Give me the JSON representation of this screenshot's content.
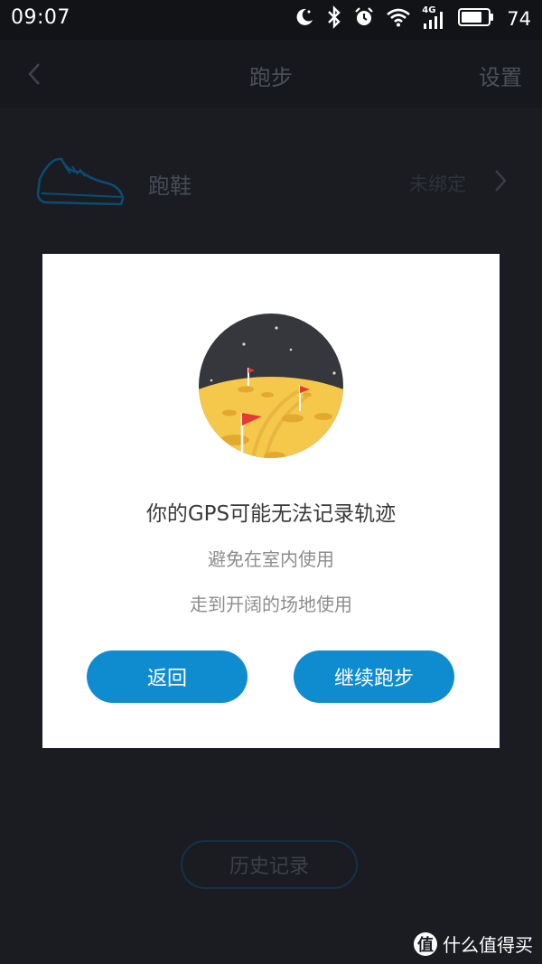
{
  "status_bar": {
    "time": "09:07",
    "battery_level": "74",
    "network_label": "4G",
    "icons": [
      "night-mode-icon",
      "bluetooth-icon",
      "alarm-icon",
      "wifi-icon",
      "signal-icon",
      "battery-icon"
    ]
  },
  "header": {
    "back_icon": "chevron-left-icon",
    "title": "跑步",
    "settings_label": "设置"
  },
  "shoe": {
    "icon": "running-shoe-icon",
    "label": "跑鞋",
    "status": "未绑定",
    "chevron_icon": "chevron-right-icon"
  },
  "dialog": {
    "illustration": "moon-flags-illustration",
    "title": "你的GPS可能无法记录轨迹",
    "tips": [
      "避免在室内使用",
      "走到开阔的场地使用"
    ],
    "back_label": "返回",
    "continue_label": "继续跑步",
    "button_color": "#0f8cd0"
  },
  "history_label": "历史记录",
  "watermark": {
    "badge": "值",
    "text": "什么值得买"
  }
}
